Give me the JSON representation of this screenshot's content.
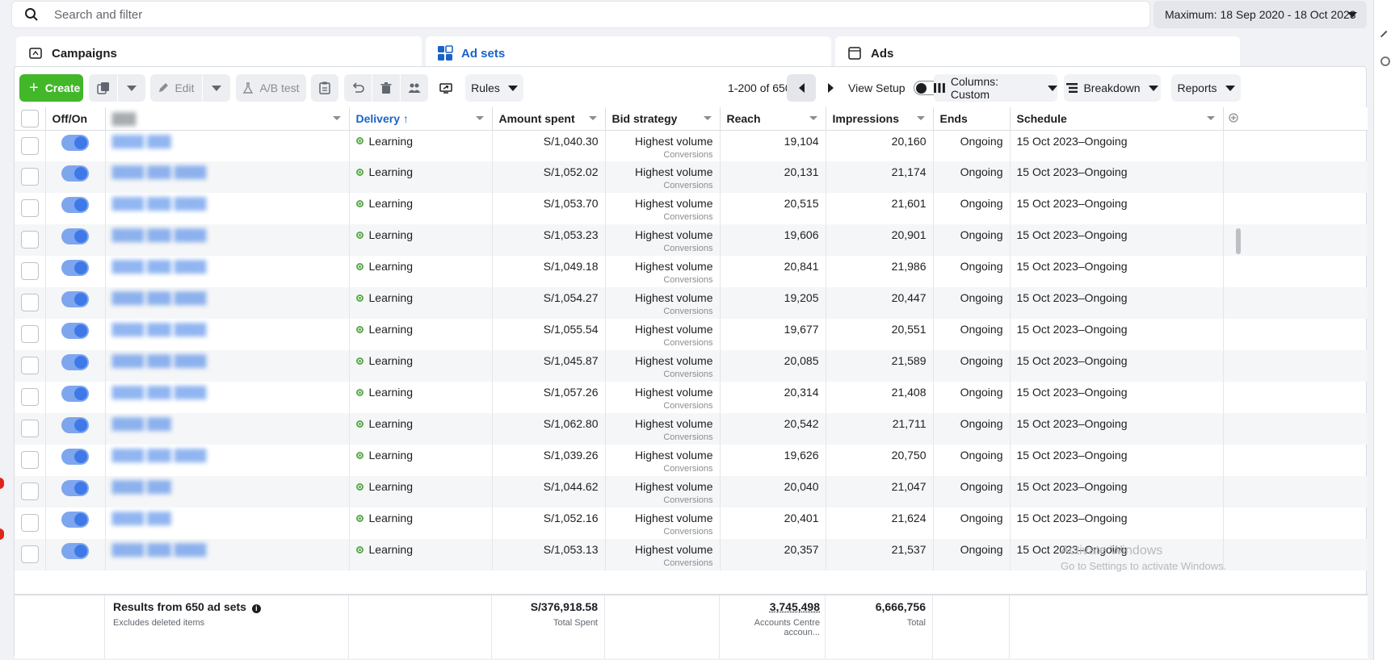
{
  "search": {
    "placeholder": "Search and filter"
  },
  "date_range": {
    "label": "Maximum: 18 Sep 2020 - 18 Oct 2023"
  },
  "tabs": [
    {
      "label": "Campaigns",
      "icon": "folder-icon",
      "active": false
    },
    {
      "label": "Ad sets",
      "icon": "grid-icon",
      "active": true
    },
    {
      "label": "Ads",
      "icon": "ad-page-icon",
      "active": false
    }
  ],
  "toolbar": {
    "create_label": "Create",
    "edit_label": "Edit",
    "ab_test_label": "A/B test",
    "rules_label": "Rules",
    "pagination": "1-200 of 650",
    "view_setup_label": "View Setup",
    "columns_label": "Columns: Custom",
    "breakdown_label": "Breakdown",
    "reports_label": "Reports"
  },
  "columns": {
    "offon": "Off/On",
    "delivery": "Delivery",
    "amount_spent": "Amount spent",
    "bid_strategy": "Bid strategy",
    "reach": "Reach",
    "impressions": "Impressions",
    "ends": "Ends",
    "schedule": "Schedule"
  },
  "rows": [
    {
      "name": "████ ███",
      "delivery": "Learning",
      "amount": "S/1,040.30",
      "bid": "Highest volume",
      "bid_sub": "Conversions",
      "reach": "19,104",
      "impressions": "20,160",
      "ends": "Ongoing",
      "schedule": "15 Oct 2023–Ongoing"
    },
    {
      "name": "████ ███ ████",
      "delivery": "Learning",
      "amount": "S/1,052.02",
      "bid": "Highest volume",
      "bid_sub": "Conversions",
      "reach": "20,131",
      "impressions": "21,174",
      "ends": "Ongoing",
      "schedule": "15 Oct 2023–Ongoing"
    },
    {
      "name": "████ ███ ████",
      "delivery": "Learning",
      "amount": "S/1,053.70",
      "bid": "Highest volume",
      "bid_sub": "Conversions",
      "reach": "20,515",
      "impressions": "21,601",
      "ends": "Ongoing",
      "schedule": "15 Oct 2023–Ongoing"
    },
    {
      "name": "████ ███ ████",
      "delivery": "Learning",
      "amount": "S/1,053.23",
      "bid": "Highest volume",
      "bid_sub": "Conversions",
      "reach": "19,606",
      "impressions": "20,901",
      "ends": "Ongoing",
      "schedule": "15 Oct 2023–Ongoing"
    },
    {
      "name": "████ ███ ████",
      "delivery": "Learning",
      "amount": "S/1,049.18",
      "bid": "Highest volume",
      "bid_sub": "Conversions",
      "reach": "20,841",
      "impressions": "21,986",
      "ends": "Ongoing",
      "schedule": "15 Oct 2023–Ongoing"
    },
    {
      "name": "████ ███ ████",
      "delivery": "Learning",
      "amount": "S/1,054.27",
      "bid": "Highest volume",
      "bid_sub": "Conversions",
      "reach": "19,205",
      "impressions": "20,447",
      "ends": "Ongoing",
      "schedule": "15 Oct 2023–Ongoing"
    },
    {
      "name": "████ ███ ████",
      "delivery": "Learning",
      "amount": "S/1,055.54",
      "bid": "Highest volume",
      "bid_sub": "Conversions",
      "reach": "19,677",
      "impressions": "20,551",
      "ends": "Ongoing",
      "schedule": "15 Oct 2023–Ongoing"
    },
    {
      "name": "████ ███ ████",
      "delivery": "Learning",
      "amount": "S/1,045.87",
      "bid": "Highest volume",
      "bid_sub": "Conversions",
      "reach": "20,085",
      "impressions": "21,589",
      "ends": "Ongoing",
      "schedule": "15 Oct 2023–Ongoing"
    },
    {
      "name": "████ ███ ████",
      "delivery": "Learning",
      "amount": "S/1,057.26",
      "bid": "Highest volume",
      "bid_sub": "Conversions",
      "reach": "20,314",
      "impressions": "21,408",
      "ends": "Ongoing",
      "schedule": "15 Oct 2023–Ongoing"
    },
    {
      "name": "████ ███",
      "delivery": "Learning",
      "amount": "S/1,062.80",
      "bid": "Highest volume",
      "bid_sub": "Conversions",
      "reach": "20,542",
      "impressions": "21,711",
      "ends": "Ongoing",
      "schedule": "15 Oct 2023–Ongoing"
    },
    {
      "name": "████ ███ ████",
      "delivery": "Learning",
      "amount": "S/1,039.26",
      "bid": "Highest volume",
      "bid_sub": "Conversions",
      "reach": "19,626",
      "impressions": "20,750",
      "ends": "Ongoing",
      "schedule": "15 Oct 2023–Ongoing"
    },
    {
      "name": "████ ███",
      "delivery": "Learning",
      "amount": "S/1,044.62",
      "bid": "Highest volume",
      "bid_sub": "Conversions",
      "reach": "20,040",
      "impressions": "21,047",
      "ends": "Ongoing",
      "schedule": "15 Oct 2023–Ongoing"
    },
    {
      "name": "████ ███",
      "delivery": "Learning",
      "amount": "S/1,052.16",
      "bid": "Highest volume",
      "bid_sub": "Conversions",
      "reach": "20,401",
      "impressions": "21,624",
      "ends": "Ongoing",
      "schedule": "15 Oct 2023–Ongoing"
    },
    {
      "name": "████ ███ ████",
      "delivery": "Learning",
      "amount": "S/1,053.13",
      "bid": "Highest volume",
      "bid_sub": "Conversions",
      "reach": "20,357",
      "impressions": "21,537",
      "ends": "Ongoing",
      "schedule": "15 Oct 2023–Ongoing"
    }
  ],
  "footer": {
    "results_label": "Results from 650 ad sets",
    "excludes_label": "Excludes deleted items",
    "total_spent": "S/376,918.58",
    "total_spent_label": "Total Spent",
    "total_reach": "3,745,498",
    "total_reach_label": "Accounts Centre accoun...",
    "total_impressions": "6,666,756",
    "total_impressions_label": "Total"
  },
  "watermark": {
    "line1": "Activate Windows",
    "line2": "Go to Settings to activate Windows."
  },
  "colors": {
    "create_green": "#42b72a",
    "accent_blue": "#1a63c8",
    "learning_green": "#5aa94a",
    "toggle_blue": "#3f79e8"
  }
}
